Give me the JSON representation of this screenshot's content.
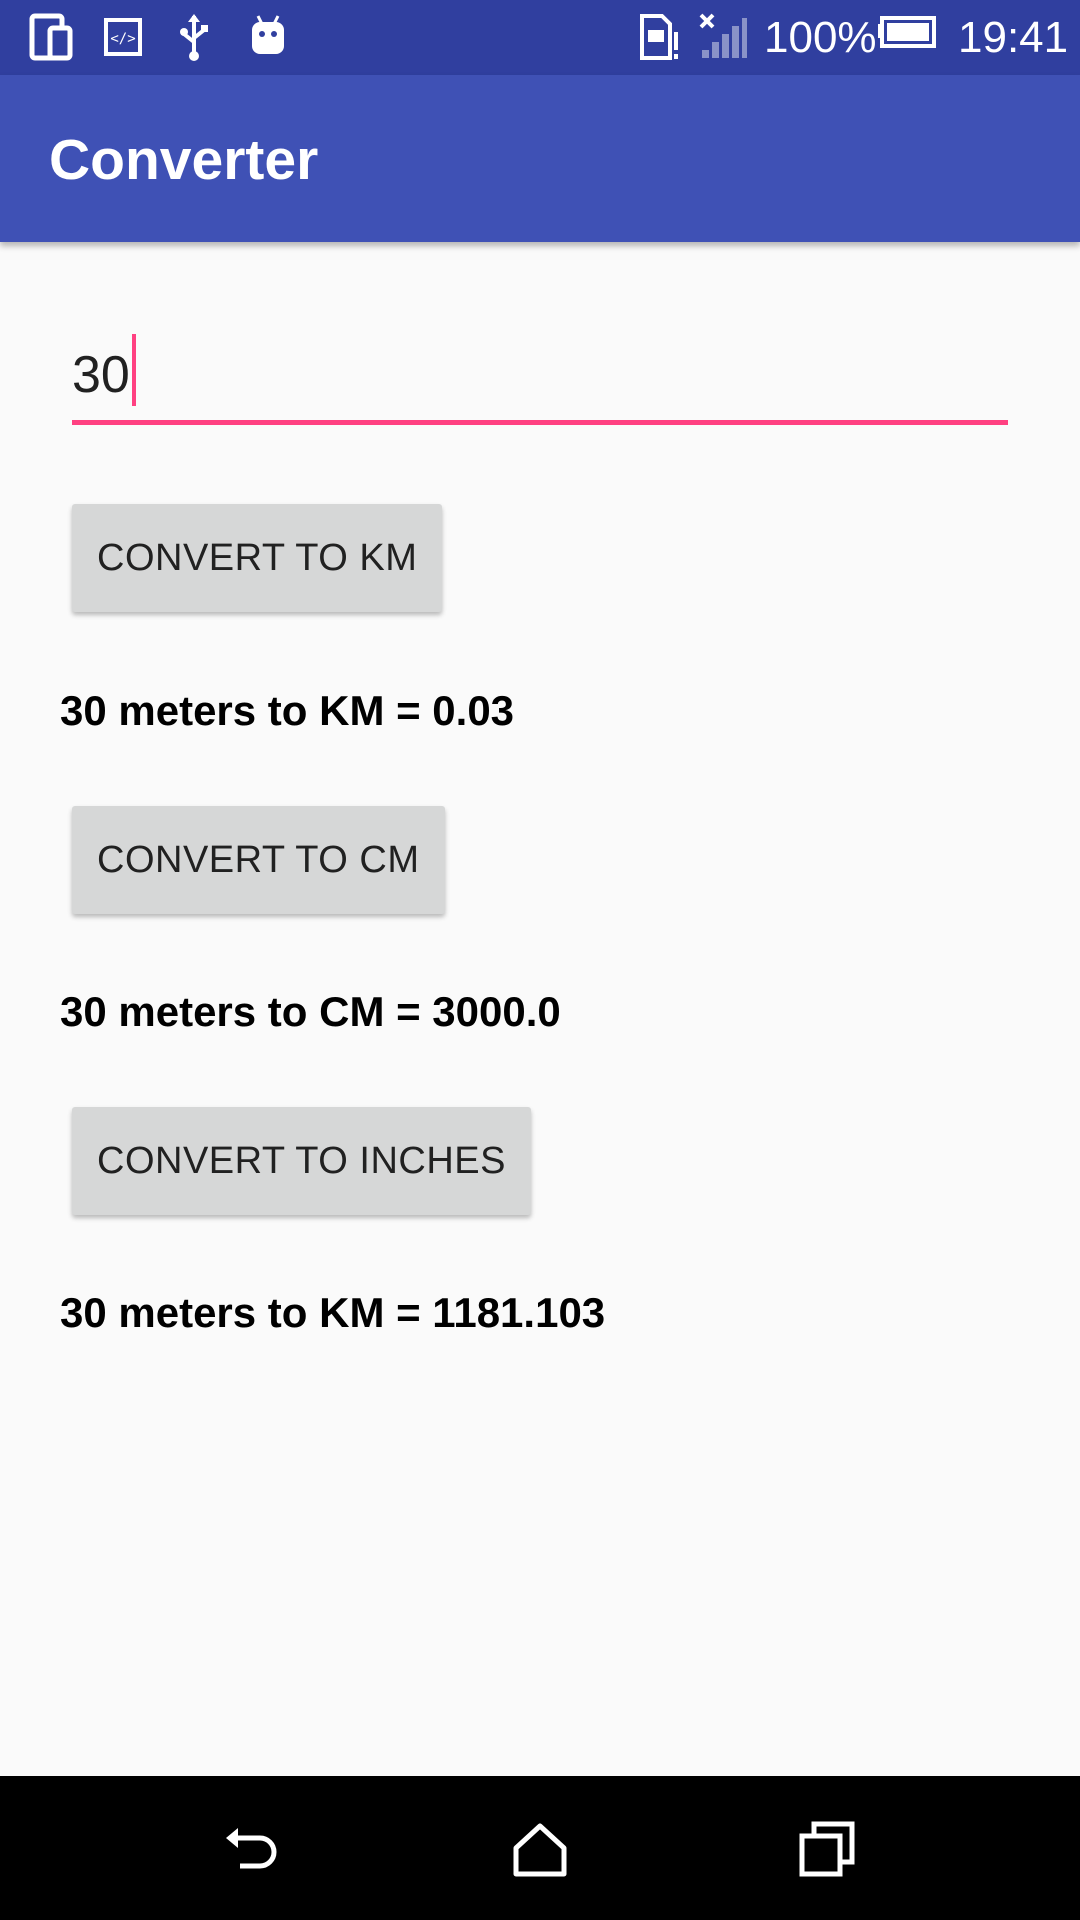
{
  "status_bar": {
    "battery": "100%",
    "time": "19:41",
    "icons": [
      "device-icon",
      "code-icon",
      "usb-icon",
      "android-icon",
      "sim-alert-icon",
      "signal-icon",
      "battery-icon"
    ]
  },
  "app_bar": {
    "title": "Converter"
  },
  "input": {
    "value": "30"
  },
  "buttons": {
    "km": "CONVERT TO KM",
    "cm": "CONVERT TO CM",
    "inches": "CONVERT TO INCHES"
  },
  "results": {
    "km": "30 meters to KM = 0.03",
    "cm": "30 meters to CM = 3000.0",
    "inches": "30 meters to KM = 1181.103"
  },
  "nav_bar": {
    "icons": [
      "back-icon",
      "home-icon",
      "recents-icon"
    ]
  },
  "colors": {
    "status_bar": "#303f9f",
    "app_bar": "#3f51b5",
    "accent": "#ff4081",
    "button": "#d6d7d7"
  }
}
